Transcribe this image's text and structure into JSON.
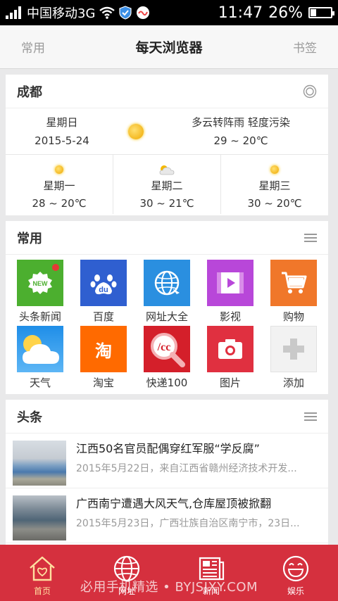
{
  "status": {
    "carrier": "中国移动3G",
    "time": "11:47",
    "battery": "26%"
  },
  "header": {
    "left": "常用",
    "title": "每天浏览器",
    "right": "书签"
  },
  "weather": {
    "city": "成都",
    "today": {
      "weekday": "星期日",
      "date": "2015-5-24",
      "condition": "多云转阵雨 轻度污染",
      "temp": "29 ~ 20℃"
    },
    "forecast": [
      {
        "weekday": "星期一",
        "temp": "28 ~ 20℃",
        "icon": "sun-icon"
      },
      {
        "weekday": "星期二",
        "temp": "30 ~ 21℃",
        "icon": "cloudy-icon"
      },
      {
        "weekday": "星期三",
        "temp": "30 ~ 20℃",
        "icon": "sun-icon"
      }
    ]
  },
  "apps": {
    "title": "常用",
    "items": [
      {
        "label": "头条新闻",
        "color": "#4caf2f",
        "icon": "new-badge-icon"
      },
      {
        "label": "百度",
        "color": "#2f5fd0",
        "icon": "baidu-paw-icon"
      },
      {
        "label": "网址大全",
        "color": "#2a8fe0",
        "icon": "globe-icon"
      },
      {
        "label": "影视",
        "color": "#b847d9",
        "icon": "film-icon"
      },
      {
        "label": "购物",
        "color": "#f0772a",
        "icon": "cart-icon"
      },
      {
        "label": "天气",
        "color": "#3aa0ea",
        "icon": "weather-icon"
      },
      {
        "label": "淘宝",
        "color": "#ff6a00",
        "icon": "taobao-icon"
      },
      {
        "label": "快递100",
        "color": "#d41f2a",
        "icon": "express-search-icon"
      },
      {
        "label": "图片",
        "color": "#e03040",
        "icon": "camera-icon"
      },
      {
        "label": "添加",
        "color": "#f2f2f2",
        "icon": "plus-icon"
      }
    ]
  },
  "news": {
    "title": "头条",
    "items": [
      {
        "headline": "江西50名官员配偶穿红军服“学反腐”",
        "summary": "2015年5月22日，来自江西省赣州经济技术开发..."
      },
      {
        "headline": "广西南宁遭遇大风天气,仓库屋顶被掀翻",
        "summary": "2015年5月23日，广西壮族自治区南宁市，23日..."
      }
    ]
  },
  "nav": {
    "items": [
      {
        "label": "首页",
        "icon": "home-icon"
      },
      {
        "label": "网址",
        "icon": "globe-icon"
      },
      {
        "label": "新闻",
        "icon": "newspaper-icon"
      },
      {
        "label": "娱乐",
        "icon": "smiley-icon"
      }
    ]
  },
  "watermark": "必用手机精选 • BYJSJXY.COM"
}
